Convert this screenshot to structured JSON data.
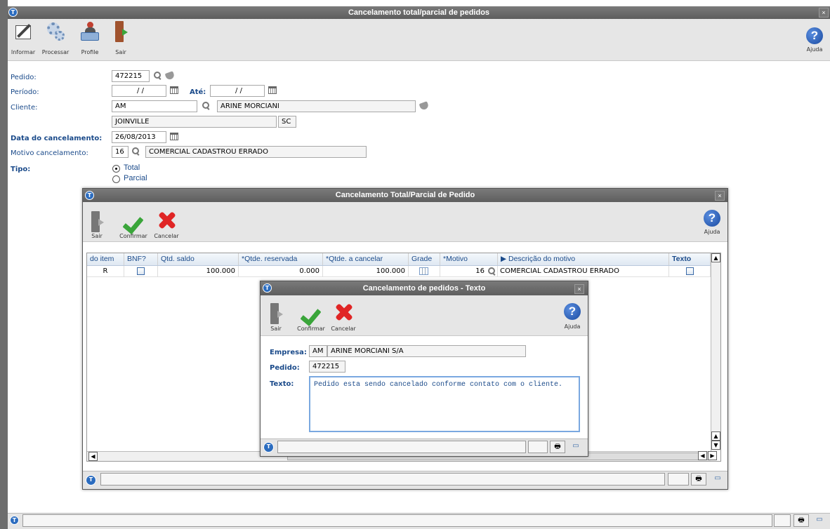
{
  "main": {
    "title": "Cancelamento total/parcial de pedidos",
    "close": "×",
    "toolbar": {
      "informar": "Informar",
      "processar": "Processar",
      "profile": "Profile",
      "sair": "Sair",
      "ajuda": "Ajuda"
    },
    "form": {
      "pedido_label": "Pedido:",
      "pedido_value": "472215",
      "periodo_label": "Período:",
      "periodo_from": "/ /",
      "ate_label": "Até:",
      "periodo_to": "/ /",
      "cliente_label": "Cliente:",
      "cliente_code": "AM",
      "cliente_name": "ARINE MORCIANI",
      "cidade": "JOINVILLE",
      "uf": "SC",
      "data_label": "Data do cancelamento:",
      "data_value": "26/08/2013",
      "motivo_label": "Motivo cancelamento:",
      "motivo_code": "16",
      "motivo_desc": "COMERCIAL CADASTROU ERRADO",
      "tipo_label": "Tipo:",
      "tipo_total": "Total",
      "tipo_parcial": "Parcial"
    }
  },
  "dialog1": {
    "title": "Cancelamento Total/Parcial de Pedido",
    "close": "×",
    "toolbar": {
      "sair": "Sair",
      "confirmar": "Confirmar",
      "cancelar": "Cancelar",
      "ajuda": "Ajuda"
    },
    "grid": {
      "headers": [
        "do item",
        "BNF?",
        "Qtd. saldo",
        "*Qtde. reservada",
        "*Qtde. a cancelar",
        "Grade",
        "*Motivo",
        "▶ Descrição do motivo",
        "Texto"
      ],
      "row": {
        "item": "R",
        "qtd_saldo": "100.000",
        "qtde_reservada": "0.000",
        "qtde_cancelar": "100.000",
        "motivo": "16",
        "descricao": "COMERCIAL CADASTROU ERRADO"
      }
    }
  },
  "dialog2": {
    "title": "Cancelamento de pedidos - Texto",
    "close": "×",
    "toolbar": {
      "sair": "Sair",
      "confirmar": "Confirmar",
      "cancelar": "Cancelar",
      "ajuda": "Ajuda"
    },
    "empresa_label": "Empresa:",
    "empresa_code": "AM",
    "empresa_name": "ARINE MORCIANI S/A",
    "pedido_label": "Pedido:",
    "pedido_value": "472215",
    "texto_label": "Texto:",
    "texto_value": "Pedido esta sendo cancelado conforme contato com o cliente."
  },
  "icons": {
    "logo": "app-logo-icon",
    "help": "help-icon",
    "magnifier": "search-icon",
    "calendar": "calendar-icon",
    "eraser": "eraser-icon"
  },
  "colors": {
    "label_blue": "#1a4a8a",
    "titlebar": "#6a6a6a",
    "confirm_green": "#3aa53a",
    "cancel_red": "#e02525"
  }
}
